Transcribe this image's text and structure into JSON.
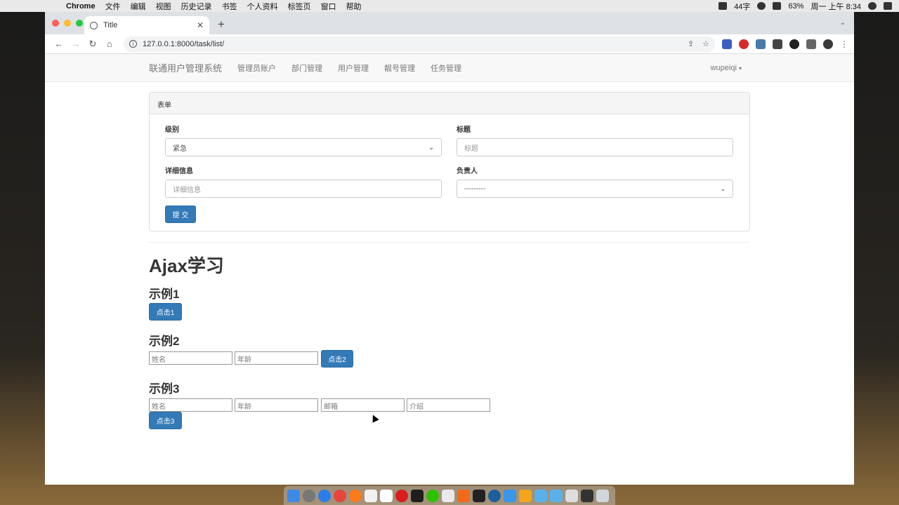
{
  "menubar": {
    "app_name": "Chrome",
    "menus": [
      "文件",
      "编辑",
      "视图",
      "历史记录",
      "书签",
      "个人资料",
      "标签页",
      "窗口",
      "帮助"
    ],
    "input_method": "44字",
    "battery": "63%",
    "clock": "周一 上午 8:34"
  },
  "browser": {
    "tab_title": "Title",
    "url": "127.0.0.1:8000/task/list/"
  },
  "navbar": {
    "brand": "联通用户管理系统",
    "links": [
      "管理员账户",
      "部门管理",
      "用户管理",
      "靓号管理",
      "任务管理"
    ],
    "user": "wupeiqi"
  },
  "form_panel": {
    "heading": "表单",
    "level_label": "级别",
    "level_value": "紧急",
    "title_label": "标题",
    "title_placeholder": "标题",
    "detail_label": "详细信息",
    "detail_placeholder": "详细信息",
    "owner_label": "负责人",
    "owner_value": "---------",
    "submit_label": "提 交"
  },
  "ajax": {
    "heading": "Ajax学习",
    "example1": {
      "title": "示例1",
      "button": "点击1"
    },
    "example2": {
      "title": "示例2",
      "name_placeholder": "姓名",
      "age_placeholder": "年龄",
      "button": "点击2"
    },
    "example3": {
      "title": "示例3",
      "name_placeholder": "姓名",
      "age_placeholder": "年龄",
      "email_placeholder": "邮箱",
      "intro_placeholder": "介绍",
      "button": "点击3"
    }
  },
  "colors": {
    "primary": "#337ab7",
    "navbar_bg": "#f8f8f8"
  }
}
